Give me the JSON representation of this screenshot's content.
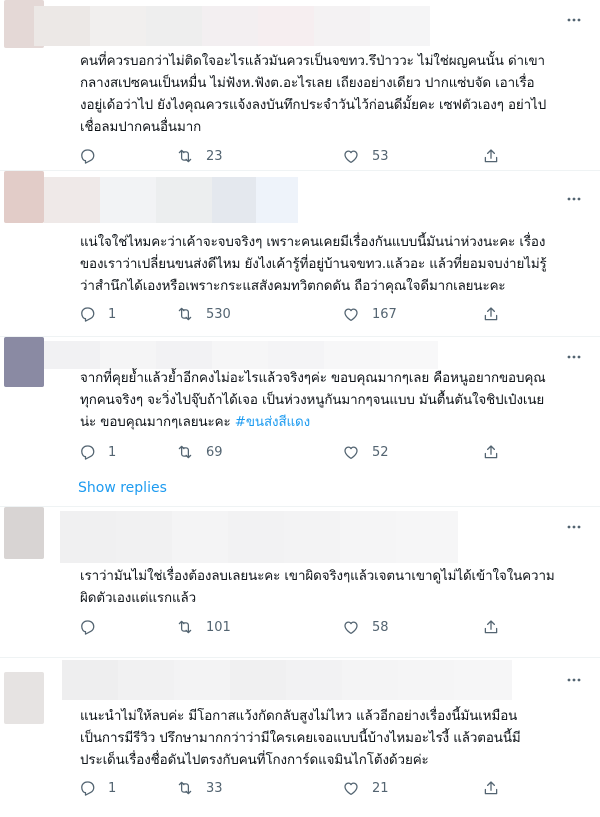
{
  "tweets": [
    {
      "text": "คนที่ควรบอกว่าไม่ติดใจอะไรแล้วมันควรเป็นจขทว.รึป่าววะ ไม่ใช่ผญคนนั้น ด่าเขา\nกลางสเปซคนเป็นหมื่น ไม่ฟังห.ฟังต.อะไรเลย เถียงอย่างเดียว ปากแซ่บจัด เอาเรื่อ\nงอยู่เด้อว่าไป ยังไงคุณควรแจ้งลงบันทึกประจำวันไว้ก่อนดีมั้ยคะ เซฟตัวเองๆ อย่าไป\nเชื่อลมปากคนอื่นมาก",
      "hashtag": "",
      "replies": "",
      "retweets": "23",
      "likes": "53"
    },
    {
      "text": "แน่ใจใช่ไหมคะว่าเค้าจะจบจริงๆ เพราะคนเคยมีเรื่องกันแบบนี้มันน่าห่วงนะคะ เรื่อง\nของเราว่าเปลี่ยนขนส่งดีไหม ยังไงเค้ารู้ที่อยู่บ้านจขทว.แล้วอะ แล้วที่ยอมจบง่ายไม่รู้\nว่าสำนึกได้เองหรือเพราะกระแสสังคมทวิตกดดัน ถือว่าคุณใจดีมากเลยนะคะ",
      "hashtag": "",
      "replies": "1",
      "retweets": "530",
      "likes": "167"
    },
    {
      "text": "จากที่คุยย้ำแล้วย้ำอีกคงไม่อะไรแล้วจริงๆค่ะ ขอบคุณมากๆเลย คือหนูอยากขอบคุณ\nทุกคนจริงๆ จะวิ่งไปจุ๊บถ้าได้เจอ เป็นห่วงหนูกันมากๆจนแบบ มันตื้นตันใจชิปเป๋งเนย\nน่ะ ขอบคุณมากๆเลยนะคะ ",
      "hashtag": "#ขนส่งสีแดง",
      "replies": "1",
      "retweets": "69",
      "likes": "52"
    },
    {
      "text": "เราว่ามันไม่ใช่เรื่องต้องลบเลยนะคะ เขาผิดจริงๆแล้วเจตนาเขาดูไม่ได้เข้าใจในความ\nผิดตัวเองแต่แรกแล้ว",
      "hashtag": "",
      "replies": "",
      "retweets": "101",
      "likes": "58"
    },
    {
      "text": "แนะนำไม่ให้ลบค่ะ มีโอกาสแว้งกัดกลับสูงไม่ไหว แล้วอีกอย่างเรื่องนี้มันเหมือน\nเป็นการมีรีวิว ปรึกษามากกว่าว่ามีใครเคยเจอแบบนี้บ้างไหมอะไรงี้ แล้วตอนนี้มี\nประเด็นเรื่องชื่อดันไปตรงกับคนที่โกงการ์ดแจมินไกโต้งด้วยค่ะ",
      "hashtag": "",
      "replies": "1",
      "retweets": "33",
      "likes": "21"
    }
  ],
  "show_replies_label": "Show replies",
  "icons": {
    "reply": "reply-icon",
    "retweet": "retweet-icon",
    "like": "like-icon",
    "share": "share-icon",
    "more": "more-icon"
  },
  "colors": {
    "link": "#1d9bf0",
    "muted": "#536471",
    "divider": "#eff3f4"
  }
}
